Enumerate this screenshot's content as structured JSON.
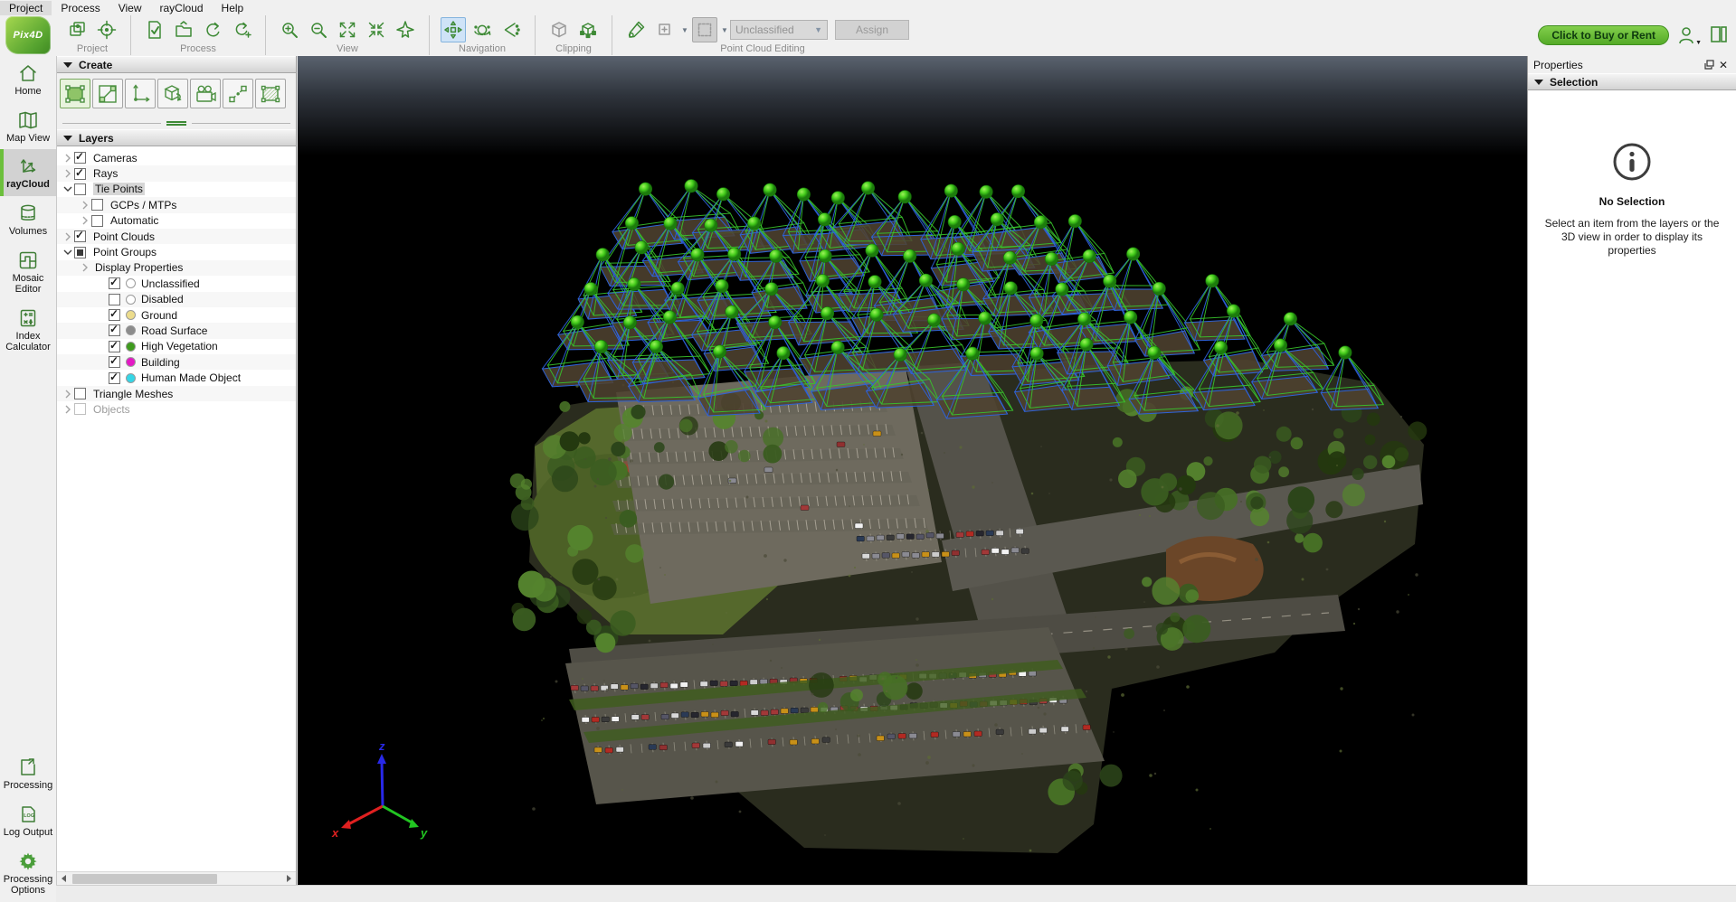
{
  "menubar": {
    "items": [
      "Project",
      "Process",
      "View",
      "rayCloud",
      "Help"
    ]
  },
  "toolbar": {
    "logo_text": "Pix4D",
    "groups": {
      "project": {
        "label": "Project"
      },
      "process": {
        "label": "Process"
      },
      "view": {
        "label": "View"
      },
      "navigation": {
        "label": "Navigation"
      },
      "clipping": {
        "label": "Clipping"
      },
      "point_cloud_editing": {
        "label": "Point Cloud Editing"
      }
    },
    "class_dropdown_value": "Unclassified",
    "assign_label": "Assign",
    "buy_button_label": "Click to Buy or Rent"
  },
  "nav_rail": {
    "top_items": [
      {
        "id": "home",
        "label": "Home",
        "active": false
      },
      {
        "id": "map-view",
        "label": "Map View",
        "active": false
      },
      {
        "id": "raycloud",
        "label": "rayCloud",
        "active": true
      },
      {
        "id": "volumes",
        "label": "Volumes",
        "active": false
      },
      {
        "id": "mosaic-editor",
        "label": "Mosaic Editor",
        "active": false
      },
      {
        "id": "index-calculator",
        "label": "Index Calculator",
        "active": false
      }
    ],
    "bottom_items": [
      {
        "id": "processing",
        "label": "Processing"
      },
      {
        "id": "log-output",
        "label": "Log Output"
      },
      {
        "id": "processing-options",
        "label": "Processing Options"
      }
    ]
  },
  "create_panel": {
    "title": "Create"
  },
  "layers_panel": {
    "title": "Layers",
    "tree": [
      {
        "label": "Cameras",
        "indent": 0,
        "expander": "collapsed",
        "checkbox": "checked"
      },
      {
        "label": "Rays",
        "indent": 0,
        "expander": "collapsed",
        "checkbox": "checked"
      },
      {
        "label": "Tie Points",
        "indent": 0,
        "expander": "expanded",
        "checkbox": "unchecked",
        "selected": true
      },
      {
        "label": "GCPs / MTPs",
        "indent": 1,
        "expander": "collapsed",
        "checkbox": "unchecked"
      },
      {
        "label": "Automatic",
        "indent": 1,
        "expander": "collapsed",
        "checkbox": "unchecked"
      },
      {
        "label": "Point Clouds",
        "indent": 0,
        "expander": "collapsed",
        "checkbox": "checked"
      },
      {
        "label": "Point Groups",
        "indent": 0,
        "expander": "expanded",
        "checkbox": "partial"
      },
      {
        "label": "Display Properties",
        "indent": 1,
        "expander": "collapsed",
        "checkbox": "none"
      },
      {
        "label": "Unclassified",
        "indent": 2,
        "expander": "none",
        "checkbox": "checked",
        "dot": "#ffffff"
      },
      {
        "label": "Disabled",
        "indent": 2,
        "expander": "none",
        "checkbox": "unchecked",
        "dot": "#ffffff"
      },
      {
        "label": "Ground",
        "indent": 2,
        "expander": "none",
        "checkbox": "checked",
        "dot": "#ecdc8c"
      },
      {
        "label": "Road Surface",
        "indent": 2,
        "expander": "none",
        "checkbox": "checked",
        "dot": "#8c8c8c"
      },
      {
        "label": "High Vegetation",
        "indent": 2,
        "expander": "none",
        "checkbox": "checked",
        "dot": "#3f9b1e"
      },
      {
        "label": "Building",
        "indent": 2,
        "expander": "none",
        "checkbox": "checked",
        "dot": "#e318c4"
      },
      {
        "label": "Human Made Object",
        "indent": 2,
        "expander": "none",
        "checkbox": "checked",
        "dot": "#35d6e6"
      },
      {
        "label": "Triangle Meshes",
        "indent": 0,
        "expander": "collapsed",
        "checkbox": "unchecked"
      },
      {
        "label": "Objects",
        "indent": 0,
        "expander": "collapsed",
        "checkbox": "unchecked",
        "disabled": true
      }
    ]
  },
  "properties_panel": {
    "title": "Properties",
    "section_title": "Selection",
    "no_selection_title": "No Selection",
    "no_selection_message": "Select an item from the layers or the 3D view in order to display its properties"
  },
  "viewport": {
    "axis_labels": {
      "x": "x",
      "y": "y",
      "z": "z"
    },
    "colors": {
      "camera_sphere": "#46cf1d",
      "frustum_blue": "#2e62d9",
      "frustum_green": "#38c42c",
      "axis_x": "#e02020",
      "axis_y": "#22c522",
      "axis_z": "#2828e8"
    },
    "camera_grid": {
      "rows": 6,
      "total_cameras": 78
    }
  }
}
